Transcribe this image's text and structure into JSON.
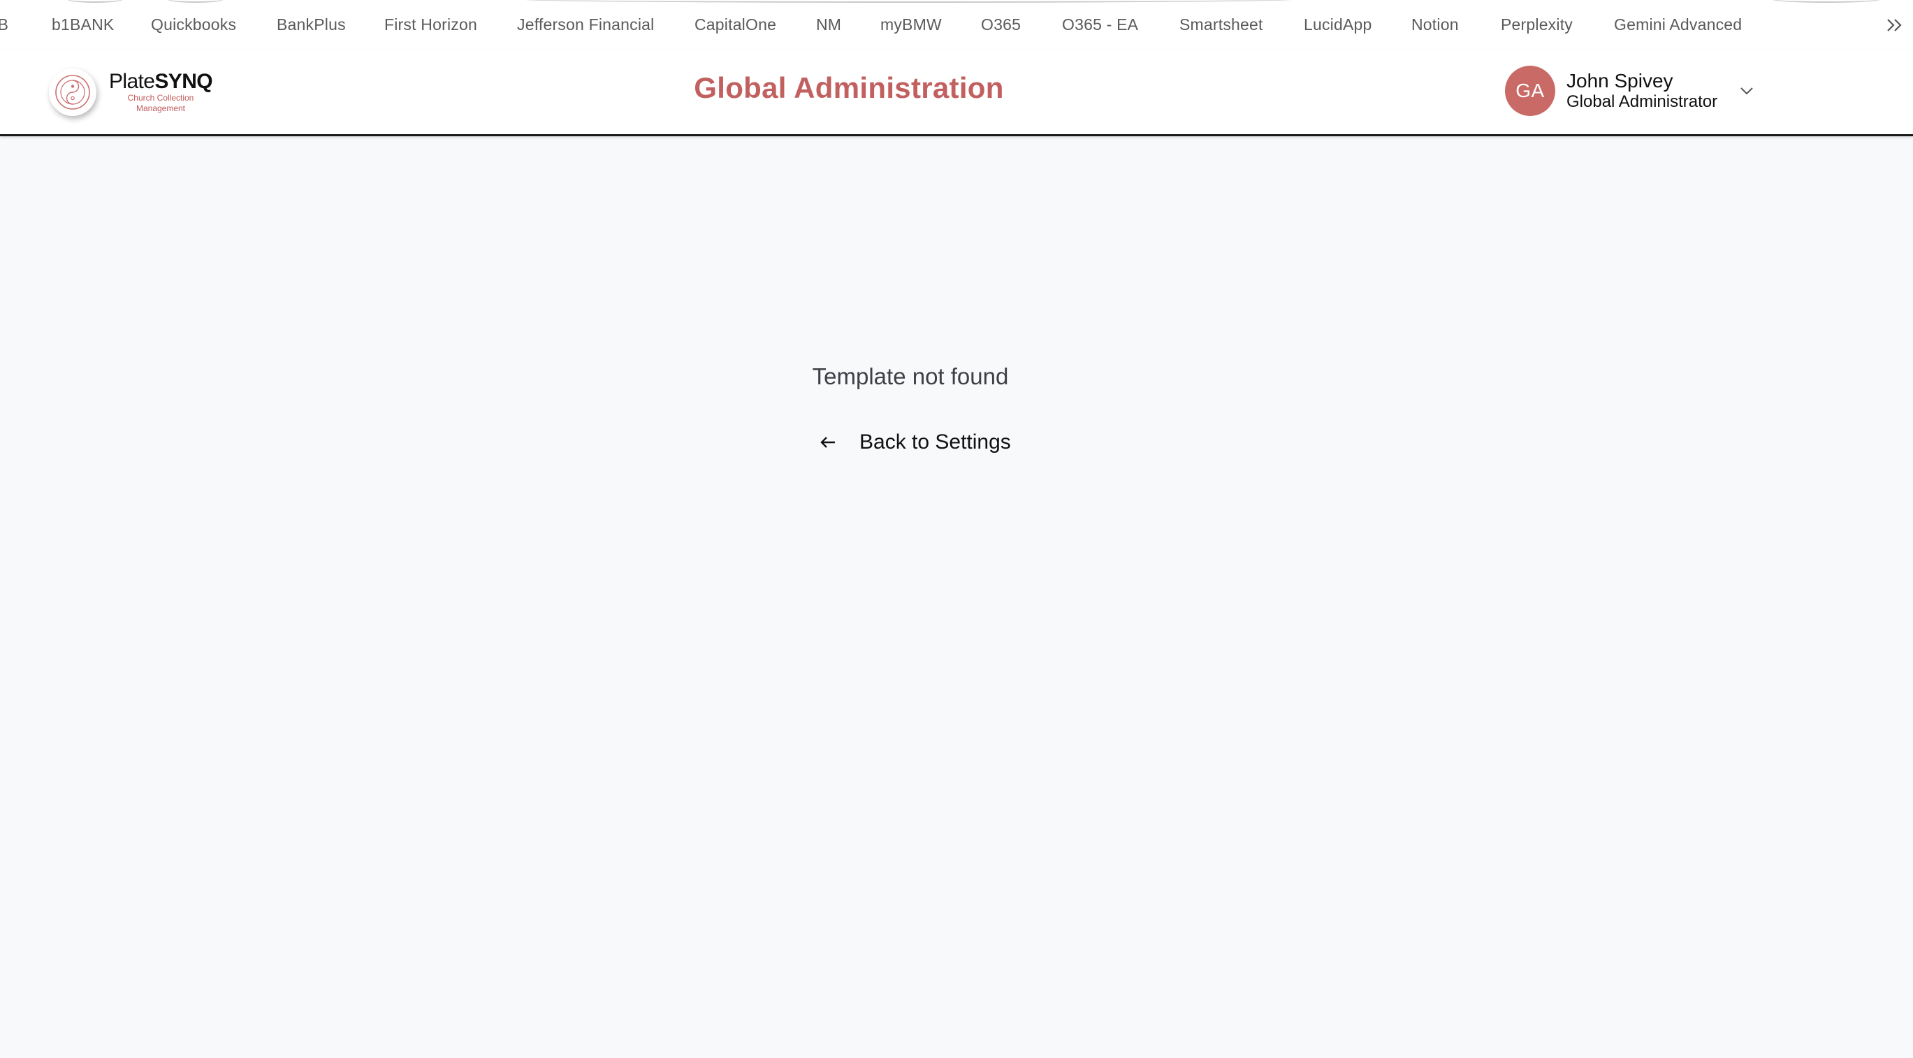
{
  "bookmarks": {
    "items": [
      {
        "label": "'B"
      },
      {
        "label": "b1BANK"
      },
      {
        "label": "Quickbooks"
      },
      {
        "label": "BankPlus"
      },
      {
        "label": "First Horizon"
      },
      {
        "label": "Jefferson Financial"
      },
      {
        "label": "CapitalOne"
      },
      {
        "label": "NM"
      },
      {
        "label": "myBMW"
      },
      {
        "label": "O365"
      },
      {
        "label": "O365 - EA"
      },
      {
        "label": "Smartsheet"
      },
      {
        "label": "LucidApp"
      },
      {
        "label": "Notion"
      },
      {
        "label": "Perplexity"
      },
      {
        "label": "Gemini Advanced"
      }
    ],
    "more_icon": "double-chevron-right-icon"
  },
  "header": {
    "logo": {
      "name_regular": "Plate",
      "name_bold": "SYNQ",
      "subtitle": "Church Collection Management",
      "icon": "platesynq-logo-icon"
    },
    "title": "Global Administration",
    "user": {
      "initials": "GA",
      "name": "John Spivey",
      "role": "Global Administrator",
      "menu_icon": "chevron-down-icon"
    }
  },
  "main": {
    "message": "Template not found",
    "back_label": "Back to Settings",
    "back_icon": "arrow-left-icon"
  },
  "colors": {
    "brand": "#c1605f",
    "avatar": "#c96a66",
    "page_background": "#f8f9fb"
  }
}
